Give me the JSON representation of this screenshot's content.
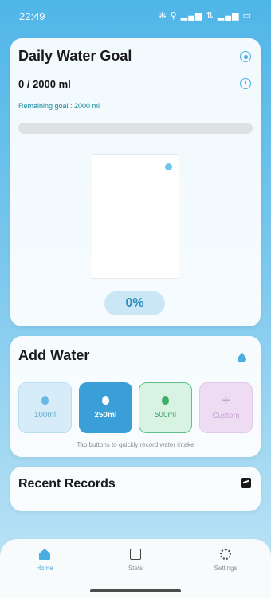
{
  "status_bar": {
    "time": "22:49",
    "icons": "✻ ⚲ ▂▄▆ ⇅ ▂▄▆ ▭"
  },
  "goal": {
    "title": "Daily Water Goal",
    "amount": "0 / 2000 ml",
    "remaining": "Remaining goal : 2000 ml",
    "progress_fraction": 0,
    "percent": "0%"
  },
  "add_water": {
    "title": "Add Water",
    "buttons": [
      {
        "label": "100ml",
        "icon": "water-drop-icon",
        "color": "#69a9cf"
      },
      {
        "label": "250ml",
        "icon": "water-drop-icon",
        "color": "#ffffff"
      },
      {
        "label": "500ml",
        "icon": "water-drop-icon",
        "color": "#44a06a"
      },
      {
        "label": "Custom",
        "icon": "plus-icon",
        "color": "#c7a3d6"
      }
    ],
    "hint": "Tap buttons to quickly record water intake"
  },
  "recent": {
    "title": "Recent Records"
  },
  "nav": {
    "home": "Home",
    "stats": "Stats",
    "settings": "Settings"
  },
  "colors": {
    "accent": "#4aaee0",
    "selected_button": "#3a9fd6"
  }
}
